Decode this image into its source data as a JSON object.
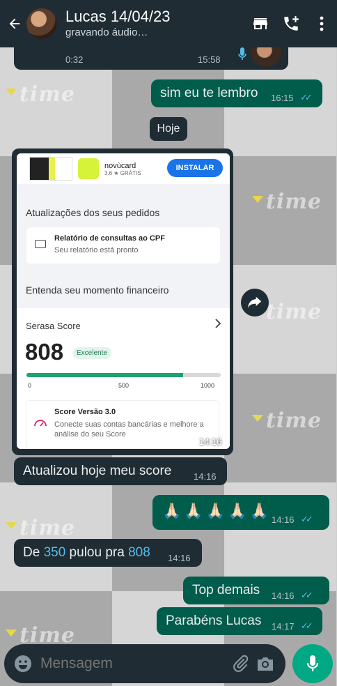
{
  "header": {
    "contact_name": "Lucas 14/04/23",
    "status": "gravando áudio…"
  },
  "voice_message": {
    "duration": "0:32",
    "time": "15:58"
  },
  "messages": {
    "m1": {
      "text": "sim eu te lembro",
      "time": "16:15"
    },
    "date_divider": "Hoje",
    "image_time": "14:16",
    "m2": {
      "text": "Atualizou hoje meu score",
      "time": "14:16"
    },
    "m3": {
      "text": "🙏🏻🙏🏻🙏🏻🙏🏻🙏🏻",
      "time": "14:16"
    },
    "m4": {
      "prefix": "De ",
      "num1": "350",
      "middle": " pulou pra ",
      "num2": "808",
      "time": "14:16"
    },
    "m5": {
      "text": "Top demais",
      "time": "14:16"
    },
    "m6": {
      "text": "Parabéns Lucas",
      "time": "14:17"
    }
  },
  "screenshot": {
    "ad": {
      "app_name": "novùcard",
      "rating": "3.6 ★",
      "price": "GRÁTIS",
      "install": "INSTALAR"
    },
    "orders_heading": "Atualizações dos seus pedidos",
    "report_title": "Relatório de consultas ao CPF",
    "report_sub": "Seu relatório está pronto",
    "financial_heading": "Entenda seu momento financeiro",
    "score_title": "Serasa Score",
    "score_value": "808",
    "score_label": "Excelente",
    "score_progress": 0.808,
    "scale": [
      "0",
      "500",
      "1000"
    ],
    "version_title": "Score Versão 3.0",
    "version_sub": "Conecte suas contas bancárias e melhore a análise do seu Score"
  },
  "wallpaper_text": "time",
  "input": {
    "placeholder": "Mensagem"
  },
  "colors": {
    "header": "#1f2c33",
    "outgoing": "#005c4b",
    "incoming": "#1f2c33",
    "accent": "#00a884",
    "read_tick": "#53bdeb"
  }
}
